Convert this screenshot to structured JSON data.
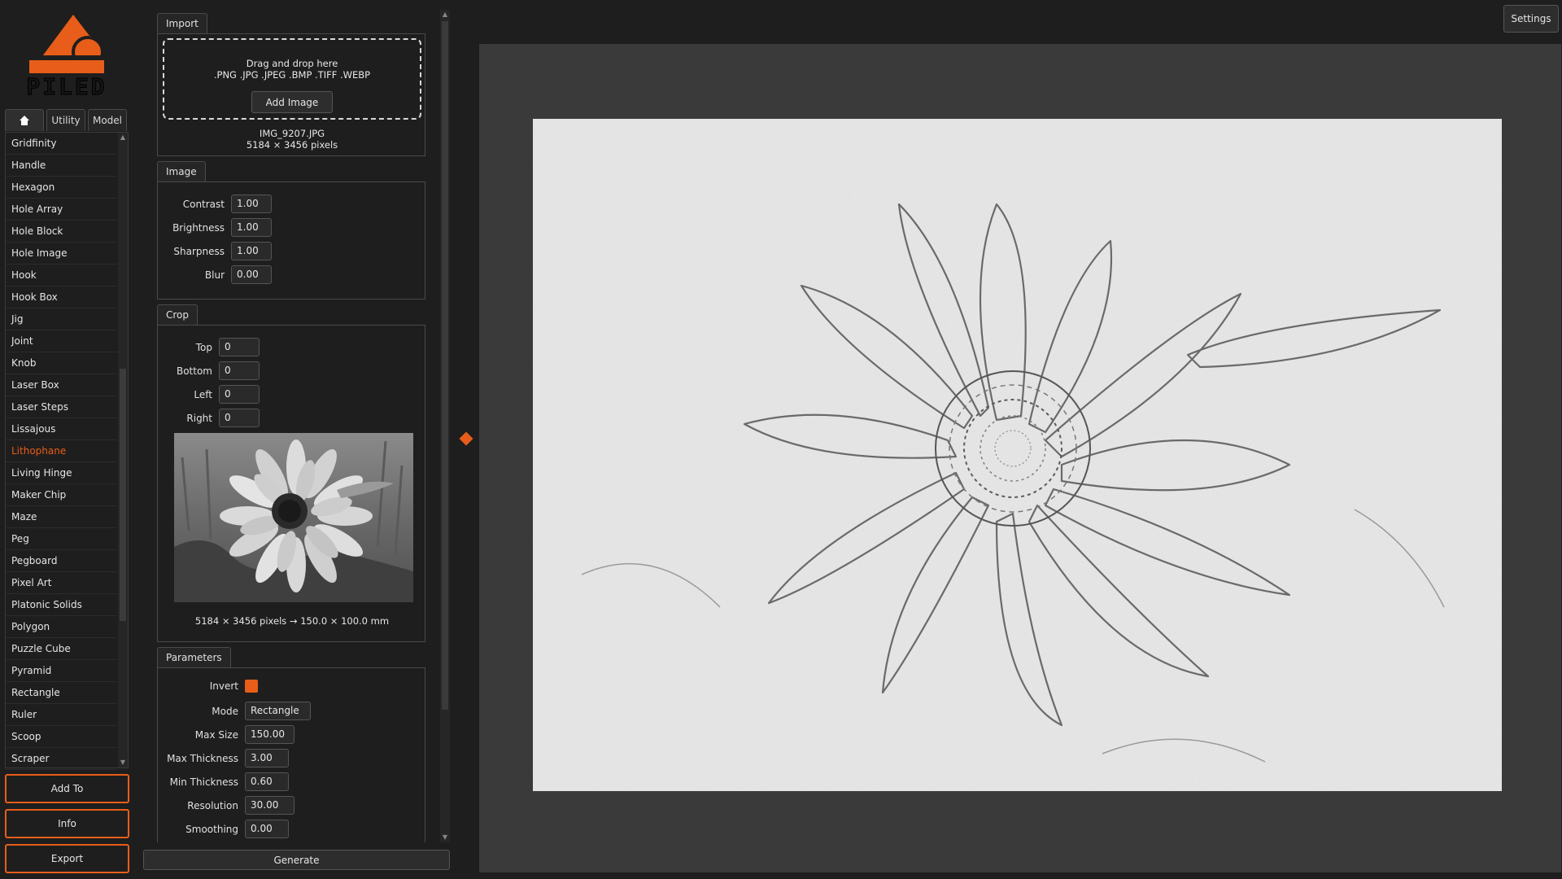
{
  "app": {
    "logo_text": "PILED",
    "accent": "#e85d1a",
    "settings_label": "Settings"
  },
  "left_tabs": [
    {
      "label": "",
      "icon": "home-icon"
    },
    {
      "label": "Utility"
    },
    {
      "label": "Model"
    }
  ],
  "models": [
    "Gridfinity",
    "Handle",
    "Hexagon",
    "Hole Array",
    "Hole Block",
    "Hole Image",
    "Hook",
    "Hook Box",
    "Jig",
    "Joint",
    "Knob",
    "Laser Box",
    "Laser Steps",
    "Lissajous",
    "Lithophane",
    "Living Hinge",
    "Maker Chip",
    "Maze",
    "Peg",
    "Pegboard",
    "Pixel Art",
    "Platonic Solids",
    "Polygon",
    "Puzzle Cube",
    "Pyramid",
    "Rectangle",
    "Ruler",
    "Scoop",
    "Scraper"
  ],
  "selected_model": "Lithophane",
  "side_buttons": {
    "add_to": "Add To",
    "info": "Info",
    "export": "Export"
  },
  "import": {
    "tab": "Import",
    "drop_line1": "Drag and drop here",
    "drop_line2": ".PNG .JPG .JPEG .BMP .TIFF .WEBP",
    "add_image": "Add Image",
    "file_name": "IMG_9207.JPG",
    "file_dims": "5184 × 3456 pixels"
  },
  "image": {
    "tab": "Image",
    "fields": [
      {
        "label": "Contrast",
        "value": "1.00"
      },
      {
        "label": "Brightness",
        "value": "1.00"
      },
      {
        "label": "Sharpness",
        "value": "1.00"
      },
      {
        "label": "Blur",
        "value": "0.00"
      }
    ]
  },
  "crop": {
    "tab": "Crop",
    "fields": [
      {
        "label": "Top",
        "value": "0"
      },
      {
        "label": "Bottom",
        "value": "0"
      },
      {
        "label": "Left",
        "value": "0"
      },
      {
        "label": "Right",
        "value": "0"
      }
    ],
    "caption": "5184 × 3456 pixels → 150.0 × 100.0 mm"
  },
  "parameters": {
    "tab": "Parameters",
    "invert_label": "Invert",
    "invert_checked": true,
    "mode_label": "Mode",
    "mode_value": "Rectangle",
    "fields": [
      {
        "label": "Max Size",
        "value": "150.00"
      },
      {
        "label": "Max Thickness",
        "value": "3.00"
      },
      {
        "label": "Min Thickness",
        "value": "0.60"
      },
      {
        "label": "Resolution",
        "value": "30.00"
      },
      {
        "label": "Smoothing",
        "value": "0.00"
      }
    ]
  },
  "generate_label": "Generate"
}
